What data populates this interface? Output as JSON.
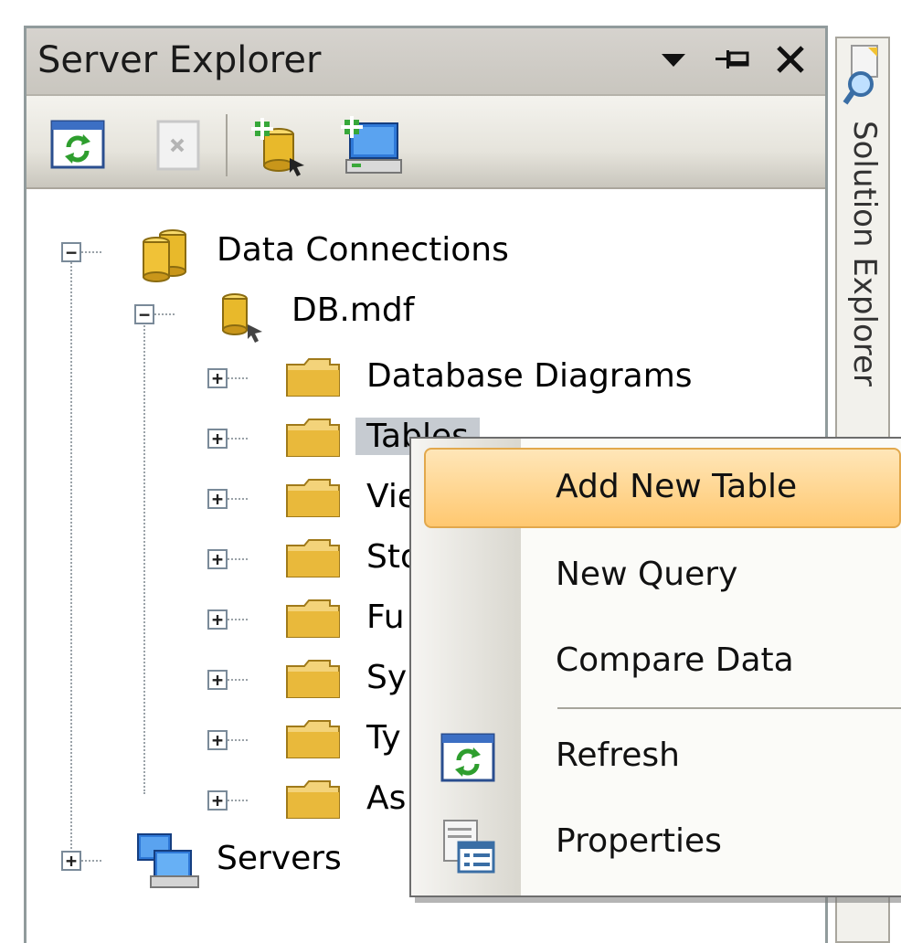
{
  "panel": {
    "title": "Server Explorer",
    "controls": [
      "dropdown-icon",
      "pin-icon",
      "close-icon"
    ]
  },
  "toolbar": {
    "buttons": [
      "refresh-icon",
      "stop-refresh-icon",
      "connect-to-database-icon",
      "connect-to-server-icon"
    ]
  },
  "tree": {
    "data_connections": "Data Connections",
    "db": "DB.mdf",
    "folders": [
      "Database Diagrams",
      "Tables",
      "Vie",
      "Sto",
      "Fu",
      "Sy",
      "Ty",
      "As"
    ],
    "servers": "Servers",
    "selected": "Tables"
  },
  "side_tab": {
    "label": "Solution Explorer"
  },
  "context_menu": {
    "items": [
      {
        "label": "Add New Table",
        "highlighted": true
      },
      {
        "label": "New Query"
      },
      {
        "label": "Compare Data"
      },
      {
        "label": "Refresh",
        "icon": "refresh-icon"
      },
      {
        "label": "Properties",
        "icon": "properties-icon"
      }
    ]
  },
  "colors": {
    "highlight": "#ffc870",
    "selection": "#c6cbd1",
    "titlebar": "#d6d3ce"
  }
}
